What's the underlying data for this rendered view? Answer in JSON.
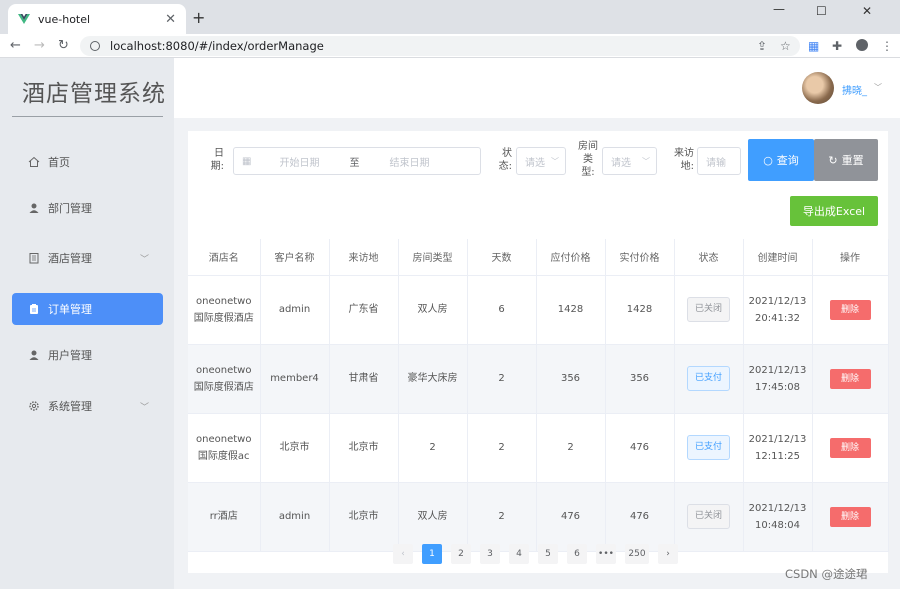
{
  "browser": {
    "tab_title": "vue-hotel",
    "url": "localhost:8080/#/index/orderManage"
  },
  "sidebar": {
    "logo": "酒店管理系统",
    "items": [
      {
        "label": "首页",
        "icon": "home-icon"
      },
      {
        "label": "部门管理",
        "icon": "user-icon"
      },
      {
        "label": "酒店管理",
        "icon": "building-icon"
      },
      {
        "label": "订单管理",
        "icon": "clipboard-icon"
      },
      {
        "label": "用户管理",
        "icon": "user-icon"
      },
      {
        "label": "系统管理",
        "icon": "gear-icon"
      }
    ]
  },
  "header": {
    "username": "拂晓_"
  },
  "filters": {
    "date_label": "日期:",
    "start_placeholder": "开始日期",
    "to": "至",
    "end_placeholder": "结束日期",
    "status_label": "状态:",
    "status_placeholder": "请选",
    "room_type_label": "房间类型:",
    "room_type_placeholder": "请选",
    "origin_label": "来访地:",
    "origin_placeholder": "请输",
    "search_btn": "查询",
    "reset_btn": "重置",
    "export_btn": "导出成Excel"
  },
  "table": {
    "headers": [
      "酒店名",
      "客户名称",
      "来访地",
      "房间类型",
      "天数",
      "应付价格",
      "实付价格",
      "状态",
      "创建时间",
      "操作"
    ],
    "rows": [
      {
        "hotel": "oneonetwo国际度假酒店",
        "customer": "admin",
        "origin": "广东省",
        "room": "双人房",
        "days": "6",
        "due": "1428",
        "paid": "1428",
        "status": "已关闭",
        "created": "2021/12/13 20:41:32",
        "op": "删除"
      },
      {
        "hotel": "oneonetwo国际度假酒店",
        "customer": "member4",
        "origin": "甘肃省",
        "room": "豪华大床房",
        "days": "2",
        "due": "356",
        "paid": "356",
        "status": "已支付",
        "created": "2021/12/13 17:45:08",
        "op": "删除"
      },
      {
        "hotel": "oneonetwo国际度假ac",
        "customer": "北京市",
        "origin": "北京市",
        "room": "2",
        "days": "2",
        "due": "2",
        "paid": "476",
        "status": "已支付",
        "created": "2021/12/13 12:11:25",
        "op": "删除"
      },
      {
        "hotel": "rr酒店",
        "customer": "admin",
        "origin": "北京市",
        "room": "双人房",
        "days": "2",
        "due": "476",
        "paid": "476",
        "status": "已关闭",
        "created": "2021/12/13 10:48:04",
        "op": "删除"
      }
    ]
  },
  "pagination": {
    "prev": "‹",
    "pages": [
      "1",
      "2",
      "3",
      "4",
      "5",
      "6",
      "•••",
      "250"
    ],
    "next": "›"
  },
  "watermark": "CSDN @途途珺",
  "colors": {
    "primary": "#409eff",
    "menu_active": "#4d8ff8",
    "export": "#67c23a",
    "danger": "#f56c6c",
    "reset": "#909399"
  }
}
